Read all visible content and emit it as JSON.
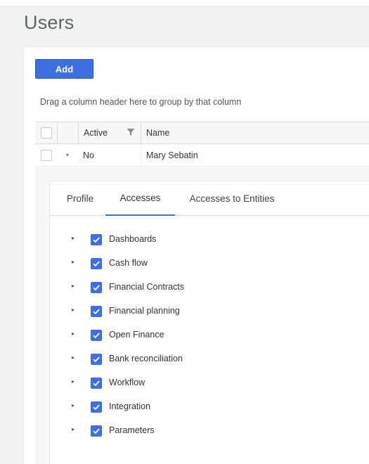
{
  "page": {
    "title": "Users"
  },
  "toolbar": {
    "add_label": "Add"
  },
  "grid": {
    "group_hint": "Drag a column header here to group by that column",
    "columns": {
      "active": "Active",
      "name": "Name"
    },
    "rows": [
      {
        "active": "No",
        "name": "Mary Sebatin"
      }
    ]
  },
  "detail": {
    "tabs": [
      {
        "label": "Profile",
        "active": false
      },
      {
        "label": "Accesses",
        "active": true
      },
      {
        "label": "Accesses to Entities",
        "active": false
      }
    ],
    "accesses": [
      {
        "label": "Dashboards",
        "checked": true
      },
      {
        "label": "Cash flow",
        "checked": true
      },
      {
        "label": "Financial Contracts",
        "checked": true
      },
      {
        "label": "Financial planning",
        "checked": true
      },
      {
        "label": "Open Finance",
        "checked": true
      },
      {
        "label": "Bank reconciliation",
        "checked": true
      },
      {
        "label": "Workflow",
        "checked": true
      },
      {
        "label": "Integration",
        "checked": true
      },
      {
        "label": "Parameters",
        "checked": true
      }
    ]
  },
  "colors": {
    "accent": "#3d6fe0",
    "background": "#f2f2f2"
  }
}
